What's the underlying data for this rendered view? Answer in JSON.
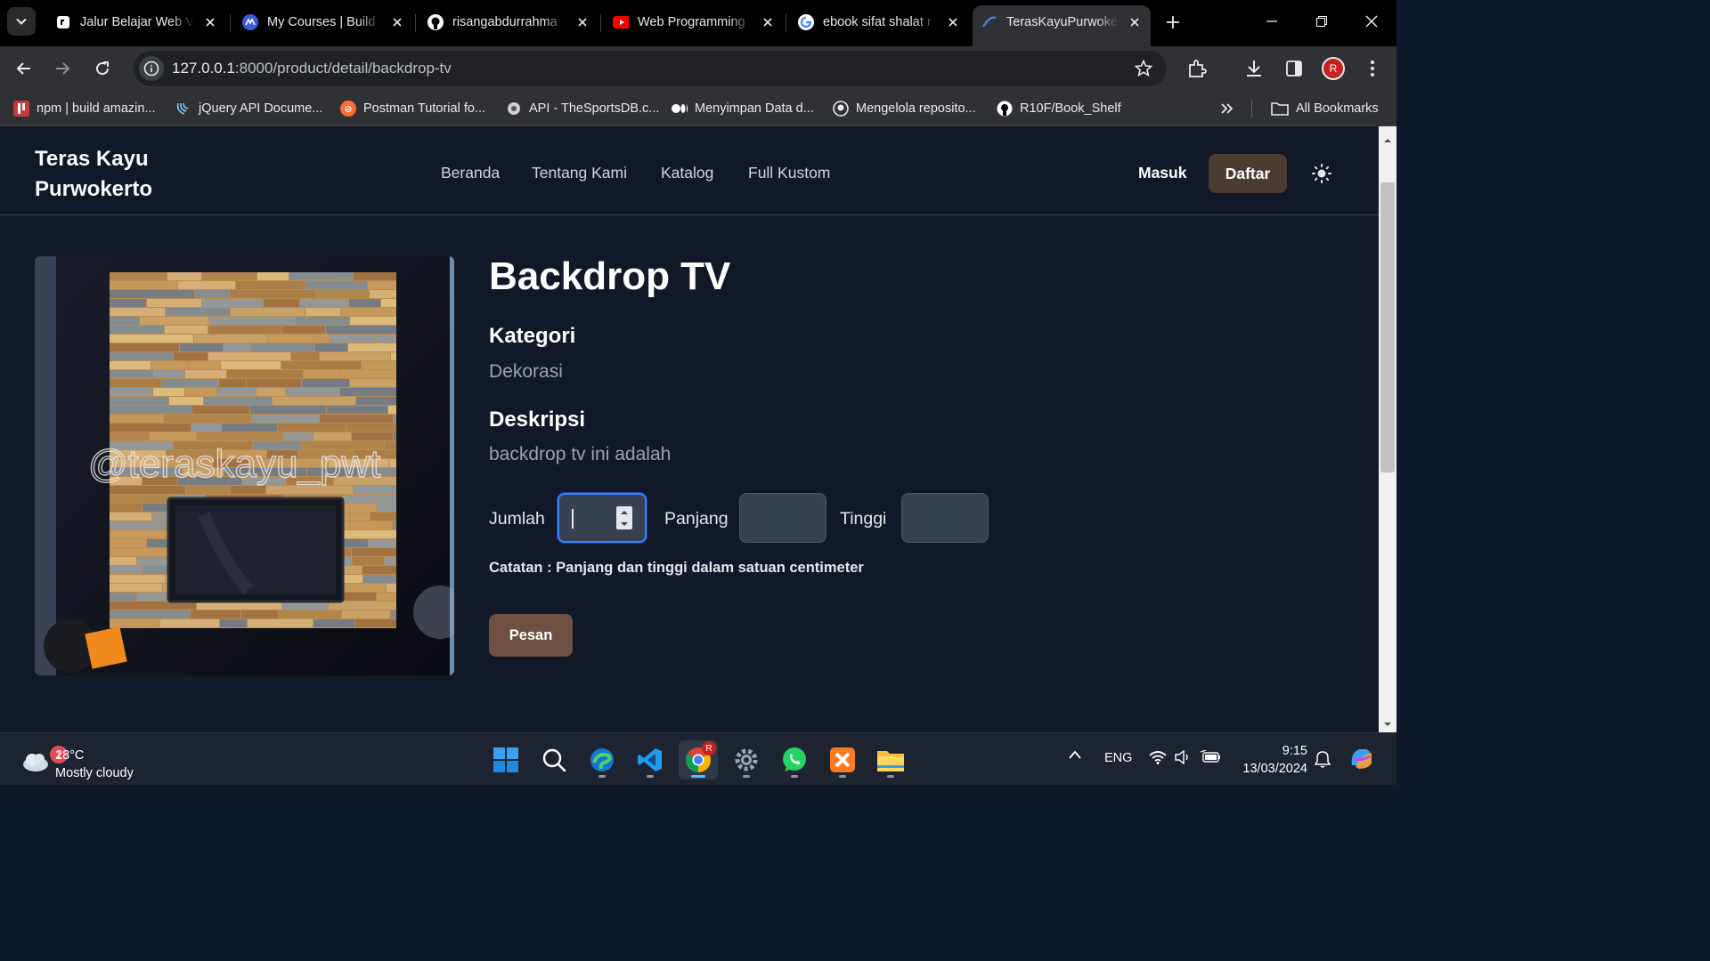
{
  "browser": {
    "tabs": [
      {
        "title": "Jalur Belajar Web V",
        "active": false
      },
      {
        "title": "My Courses | Build",
        "active": false
      },
      {
        "title": "risangabdurrahma",
        "active": false
      },
      {
        "title": "Web Programming",
        "active": false
      },
      {
        "title": "ebook sifat shalat r",
        "active": false
      },
      {
        "title": "TerasKayuPurwoke",
        "active": true
      }
    ],
    "address": {
      "host": "127.0.0.1",
      "rest": ":8000/product/detail/backdrop-tv"
    },
    "profile_initial": "R",
    "bookmarks": [
      {
        "label": "npm | build amazin..."
      },
      {
        "label": "jQuery API Docume..."
      },
      {
        "label": "Postman Tutorial fo..."
      },
      {
        "label": "API - TheSportsDB.c..."
      },
      {
        "label": "Menyimpan Data d..."
      },
      {
        "label": "Mengelola reposito..."
      },
      {
        "label": "R10F/Book_Shelf"
      }
    ],
    "all_bookmarks": "All Bookmarks"
  },
  "site": {
    "brand_line1": "Teras Kayu",
    "brand_line2": "Purwokerto",
    "nav": [
      "Beranda",
      "Tentang Kami",
      "Katalog",
      "Full Kustom"
    ],
    "login": "Masuk",
    "register": "Daftar",
    "accent_color": "#6f4f41"
  },
  "product": {
    "title": "Backdrop TV",
    "category_heading": "Kategori",
    "category": "Dekorasi",
    "description_heading": "Deskripsi",
    "description": "backdrop tv ini adalah",
    "photo_watermark": "@teraskayu_pwt",
    "fields": {
      "quantity_label": "Jumlah",
      "quantity_value": "",
      "length_label": "Panjang",
      "length_value": "",
      "height_label": "Tinggi",
      "height_value": ""
    },
    "note": "Catatan : Panjang dan tinggi dalam satuan centimeter",
    "order_button": "Pesan"
  },
  "taskbar": {
    "weather_temp": "28°C",
    "weather_desc": "Mostly cloudy",
    "weather_badge": "1",
    "language": "ENG",
    "time": "9:15",
    "date": "13/03/2024",
    "chrome_badge": "R"
  }
}
